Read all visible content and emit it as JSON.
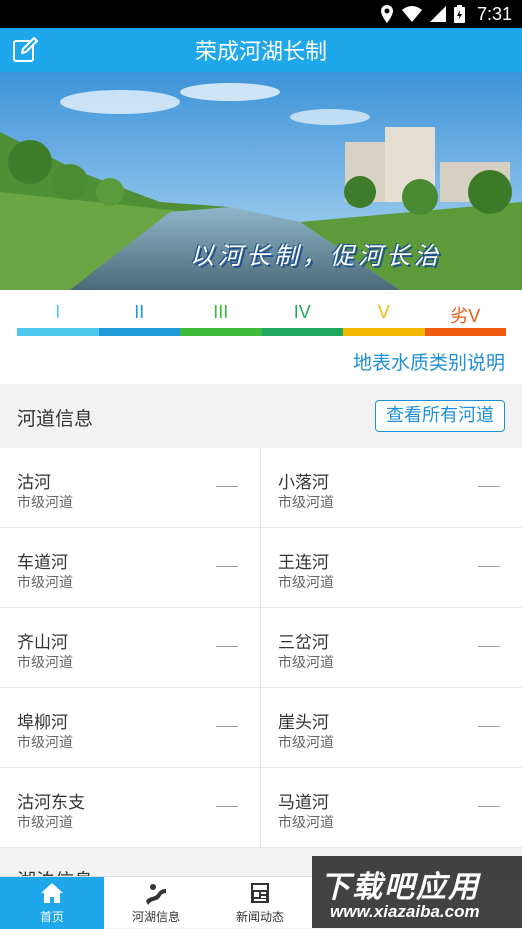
{
  "status": {
    "time": "7:31"
  },
  "header": {
    "title": "荣成河湖长制"
  },
  "banner": {
    "slogan": "以河长制，促河长治"
  },
  "quality": {
    "grades": [
      {
        "label": "I",
        "color": "#4fc8ef"
      },
      {
        "label": "II",
        "color": "#1e9ad6"
      },
      {
        "label": "III",
        "color": "#3dbb3a"
      },
      {
        "label": "IV",
        "color": "#22a85e"
      },
      {
        "label": "V",
        "color": "#f5b800"
      },
      {
        "label": "劣V",
        "color": "#ee5a10"
      }
    ],
    "explain_link": "地表水质类别说明"
  },
  "rivers_section": {
    "title": "河道信息",
    "view_all": "查看所有河道",
    "items": [
      {
        "name": "沽河",
        "level": "市级河道",
        "status": "—"
      },
      {
        "name": "小落河",
        "level": "市级河道",
        "status": "—"
      },
      {
        "name": "车道河",
        "level": "市级河道",
        "status": "—"
      },
      {
        "name": "王连河",
        "level": "市级河道",
        "status": "—"
      },
      {
        "name": "齐山河",
        "level": "市级河道",
        "status": "—"
      },
      {
        "name": "三岔河",
        "level": "市级河道",
        "status": "—"
      },
      {
        "name": "埠柳河",
        "level": "市级河道",
        "status": "—"
      },
      {
        "name": "崖头河",
        "level": "市级河道",
        "status": "—"
      },
      {
        "name": "沽河东支",
        "level": "市级河道",
        "status": "—"
      },
      {
        "name": "马道河",
        "level": "市级河道",
        "status": "—"
      }
    ]
  },
  "next_section": {
    "title": "湖泊信息"
  },
  "tabs": [
    {
      "label": "首页",
      "icon": "home-icon",
      "active": true
    },
    {
      "label": "河湖信息",
      "icon": "river-icon",
      "active": false
    },
    {
      "label": "新闻动态",
      "icon": "news-icon",
      "active": false
    },
    {
      "label": "",
      "icon": "tab-icon",
      "active": false
    },
    {
      "label": "",
      "icon": "tab-icon",
      "active": false
    }
  ],
  "watermark": {
    "line1": "下载吧应用",
    "line2": "www.xiazaiba.com"
  }
}
